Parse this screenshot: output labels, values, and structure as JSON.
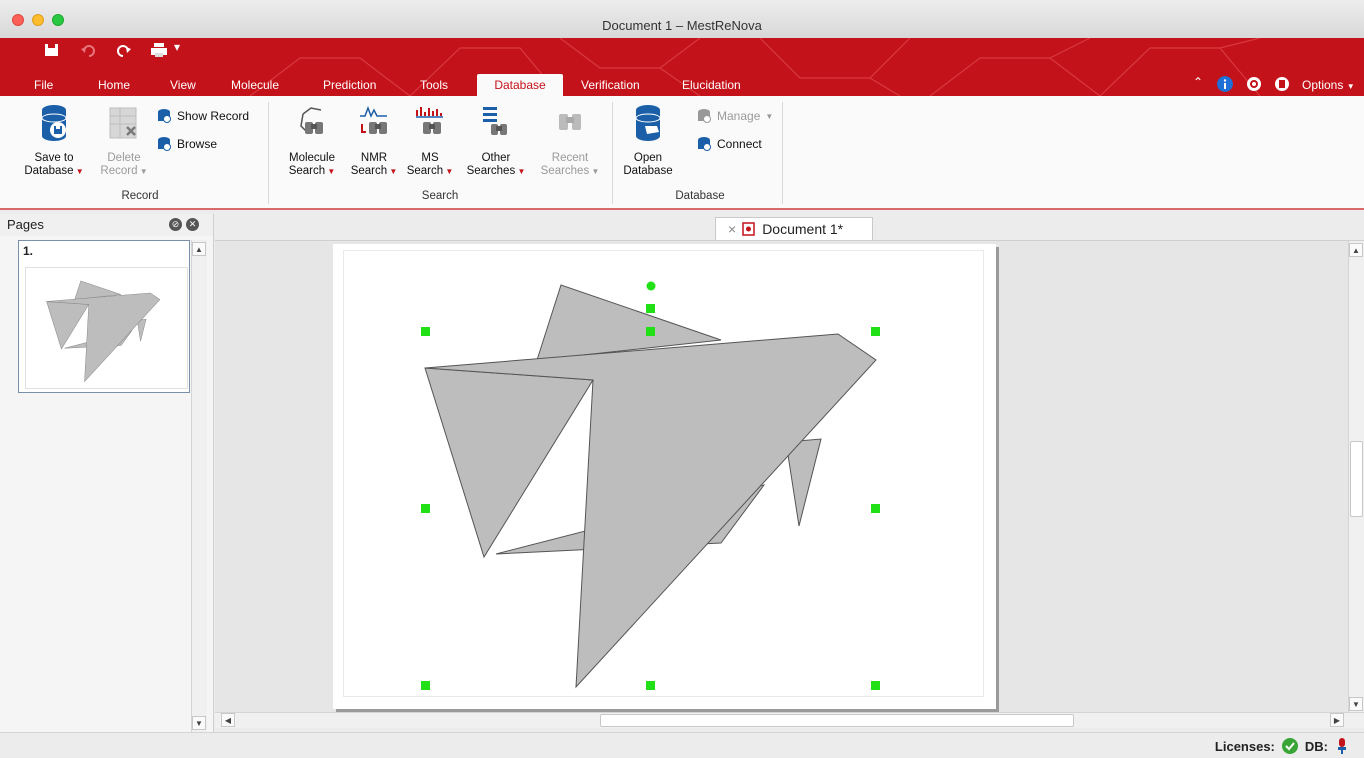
{
  "window": {
    "title": "Document 1 – MestReNova"
  },
  "ribbon": {
    "tabs": [
      "File",
      "Home",
      "View",
      "Molecule",
      "Prediction",
      "Tools",
      "Database",
      "Verification",
      "Elucidation"
    ],
    "active_tab": "Database",
    "options_label": "Options",
    "brand_color": "#c4121a",
    "groups": {
      "record": {
        "label": "Record",
        "save_line1": "Save to",
        "save_line2": "Database",
        "delete_line1": "Delete",
        "delete_line2": "Record",
        "show_record": "Show Record",
        "browse": "Browse"
      },
      "search": {
        "label": "Search",
        "molecule_line1": "Molecule",
        "molecule_line2": "Search",
        "nmr_line1": "NMR",
        "nmr_line2": "Search",
        "ms_line1": "MS",
        "ms_line2": "Search",
        "other_line1": "Other",
        "other_line2": "Searches",
        "recent_line1": "Recent",
        "recent_line2": "Searches"
      },
      "database": {
        "label": "Database",
        "open_line1": "Open",
        "open_line2": "Database",
        "manage": "Manage",
        "connect": "Connect"
      }
    }
  },
  "pages_panel": {
    "title": "Pages",
    "page_number": "1."
  },
  "document": {
    "tab_label": "Document 1*",
    "close_symbol": "×"
  },
  "status": {
    "licenses_label": "Licenses:",
    "db_label": "DB:"
  },
  "icons": [
    "save-icon",
    "undo-icon",
    "redo-icon",
    "print-icon",
    "info-icon",
    "settings-icon",
    "help-icon"
  ]
}
